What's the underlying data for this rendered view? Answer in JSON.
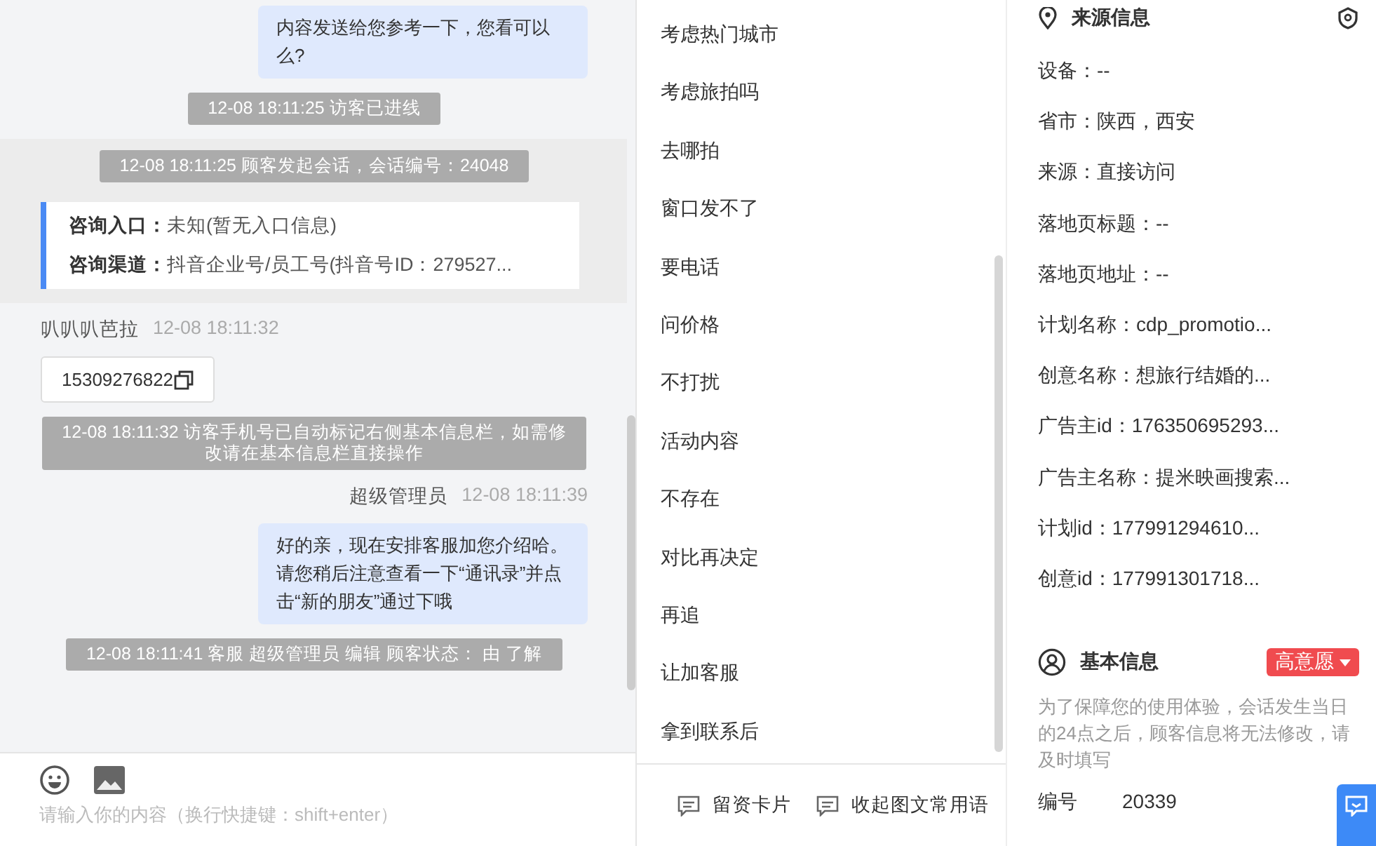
{
  "chat": {
    "messages": [
      {
        "kind": "bubble",
        "text": "内容发送给您参考一下，您看可以么?"
      },
      {
        "kind": "notice",
        "text": "12-08 18:11:25 访客已进线"
      },
      {
        "kind": "session",
        "notice": "12-08 18:11:25 顾客发起会话，会话编号：24048",
        "fields": [
          {
            "label": "咨询入口：",
            "value": "未知(暂无入口信息)"
          },
          {
            "label": "咨询渠道：",
            "value": "抖音企业号/员工号(抖音号ID：279527..."
          }
        ]
      },
      {
        "kind": "customer_sender",
        "name": "叭叭叭芭拉",
        "time": "12-08 18:11:32"
      },
      {
        "kind": "phone",
        "text": "15309276822"
      },
      {
        "kind": "notice",
        "text": "12-08 18:11:32 访客手机号已自动标记右侧基本信息栏，如需修改请在基本信息栏直接操作"
      },
      {
        "kind": "agent_sender",
        "name": "超级管理员",
        "time": "12-08 18:11:39"
      },
      {
        "kind": "bubble",
        "text": "好的亲，现在安排客服加您介绍哈。请您稍后注意查看一下“通讯录”并点击“新的朋友”通过下哦"
      },
      {
        "kind": "notice",
        "text": "12-08 18:11:41 客服 超级管理员 编辑 顾客状态： 由 了解"
      }
    ]
  },
  "composer": {
    "placeholder": "请输入你的内容（换行快捷键：shift+enter）"
  },
  "quick_replies": {
    "items": [
      "考虑热门城市",
      "考虑旅拍吗",
      "去哪拍",
      "窗口发不了",
      "要电话",
      "问价格",
      "不打扰",
      "活动内容",
      "不存在",
      "对比再决定",
      "再追",
      "让加客服",
      "拿到联系后"
    ],
    "actions": [
      "留资卡片",
      "收起图文常用语"
    ]
  },
  "source_info": {
    "title": "来源信息",
    "fields": [
      "设备：--",
      "省市：陕西，西安",
      "来源：直接访问",
      "落地页标题：--",
      "落地页地址：--",
      "计划名称：cdp_promotio...",
      "创意名称：想旅行结婚的...",
      "广告主id：176350695293...",
      "广告主名称：提米映画搜索...",
      "计划id：177991294610...",
      "创意id：177991301718..."
    ]
  },
  "basic_info": {
    "title": "基本信息",
    "tag": "高意愿",
    "note": "为了保障您的使用体验，会话发生当日的24点之后，顾客信息将无法修改，请及时填写",
    "fields": [
      {
        "label": "编号",
        "value": "20339"
      }
    ]
  }
}
